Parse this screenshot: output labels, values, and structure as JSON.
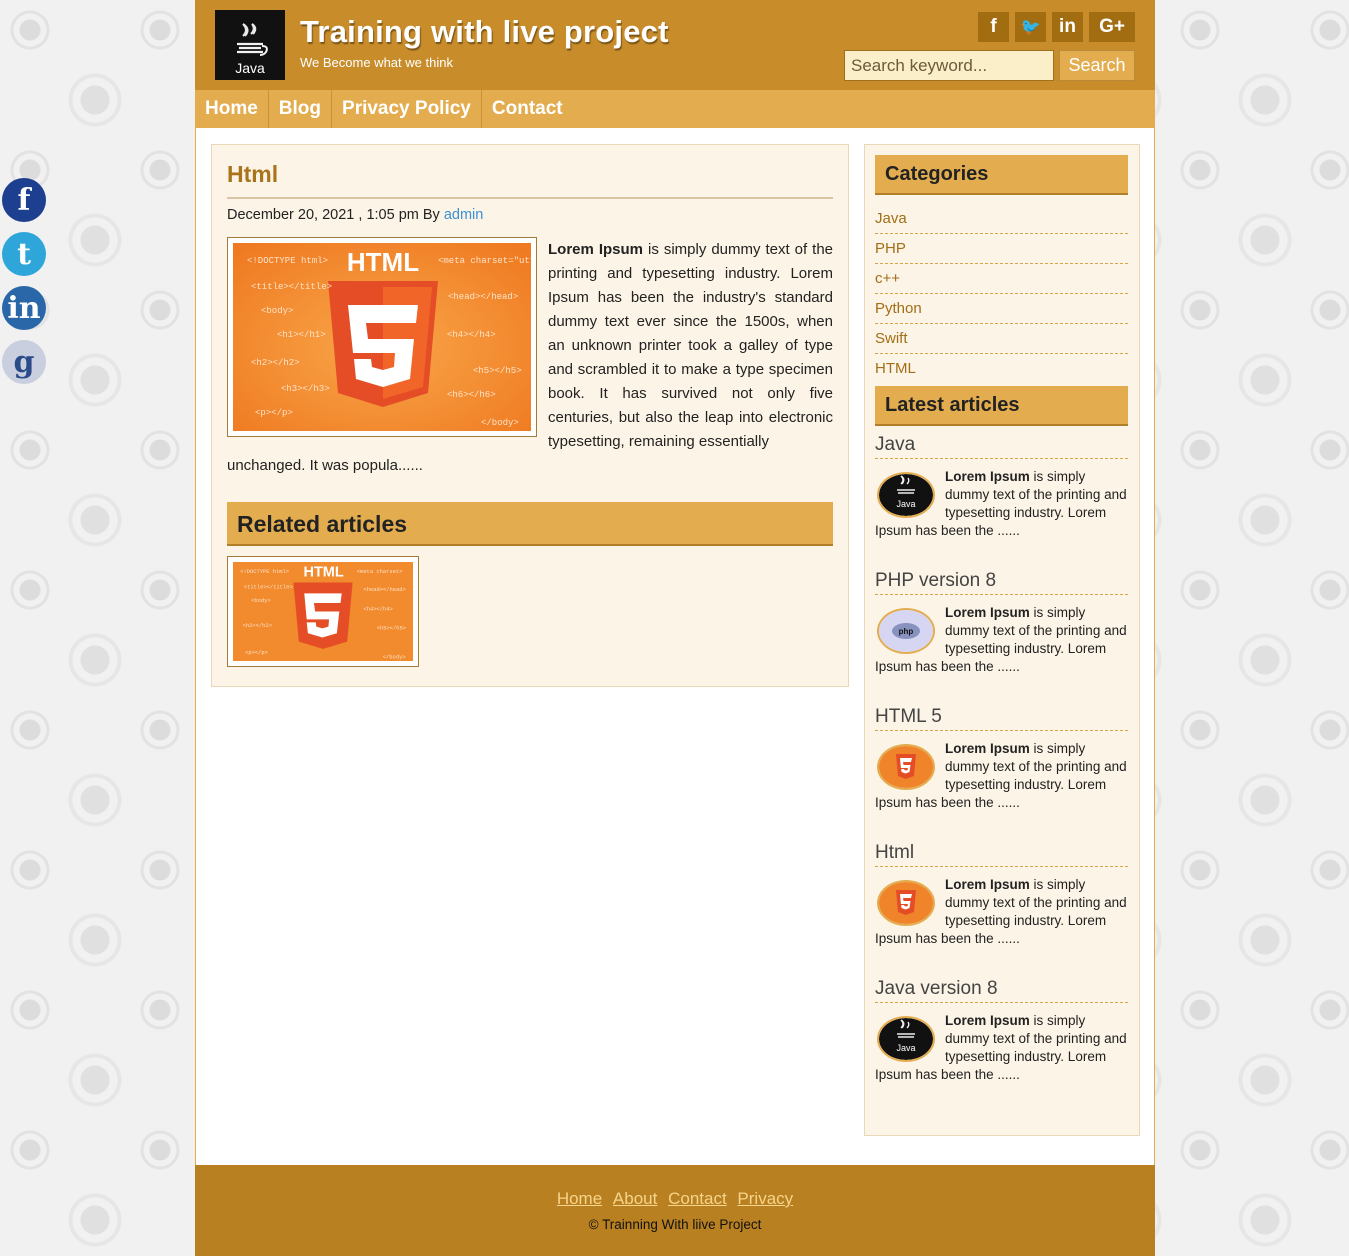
{
  "site": {
    "title": "Training with live project",
    "tagline": "We Become what we think",
    "logo_text": "Java"
  },
  "header_social": [
    "f",
    "🐦",
    "in",
    "G+"
  ],
  "search": {
    "placeholder": "Search keyword...",
    "button": "Search"
  },
  "nav": [
    "Home",
    "Blog",
    "Privacy Policy",
    "Contact"
  ],
  "post": {
    "title": "Html",
    "date": "December 20, 2021 , 1:05 pm",
    "by": "By",
    "author": "admin",
    "body_bold": "Lorem Ipsum",
    "body_right": " is simply dummy text of the printing and typesetting industry. Lorem Ipsum has been the industry's standard dummy text ever since the 1500s, when an unknown printer took a galley of type and scrambled it to make a type specimen book. It has survived not only five centuries, but also the leap into electronic typesetting, remaining essentially",
    "body_bottom": "unchanged. It was popula......",
    "image_title": "HTML"
  },
  "related": {
    "heading": "Related articles"
  },
  "sidebar": {
    "categories_heading": "Categories",
    "categories": [
      "Java",
      "PHP",
      "c++",
      "Python",
      "Swift",
      "HTML"
    ],
    "latest_heading": "Latest articles",
    "latest": [
      {
        "title": "Java",
        "thumb": "java",
        "bold": "Lorem Ipsum",
        "text": " is simply dummy text of the printing and typesetting industry. Lorem Ipsum has been the ......"
      },
      {
        "title": "PHP version 8",
        "thumb": "php",
        "bold": "Lorem Ipsum",
        "text": " is simply dummy text of the printing and typesetting industry. Lorem Ipsum has been the ......"
      },
      {
        "title": "HTML 5",
        "thumb": "html",
        "bold": "Lorem Ipsum",
        "text": " is simply dummy text of the printing and typesetting industry. Lorem Ipsum has been the ......"
      },
      {
        "title": "Html",
        "thumb": "html",
        "bold": "Lorem Ipsum",
        "text": " is simply dummy text of the printing and typesetting industry. Lorem Ipsum has been the ......"
      },
      {
        "title": "Java version 8",
        "thumb": "java",
        "bold": "Lorem Ipsum",
        "text": " is simply dummy text of the printing and typesetting industry. Lorem Ipsum has been the ......"
      }
    ]
  },
  "footer": {
    "links": [
      "Home",
      "About",
      "Contact",
      "Privacy"
    ],
    "copyright": "© Trainning With liive Project"
  },
  "colors": {
    "header": "#c88c2a",
    "nav": "#e3ad4f",
    "panel": "#fcf4e6",
    "footer": "#b88020",
    "link_blue": "#3a8fd6"
  }
}
